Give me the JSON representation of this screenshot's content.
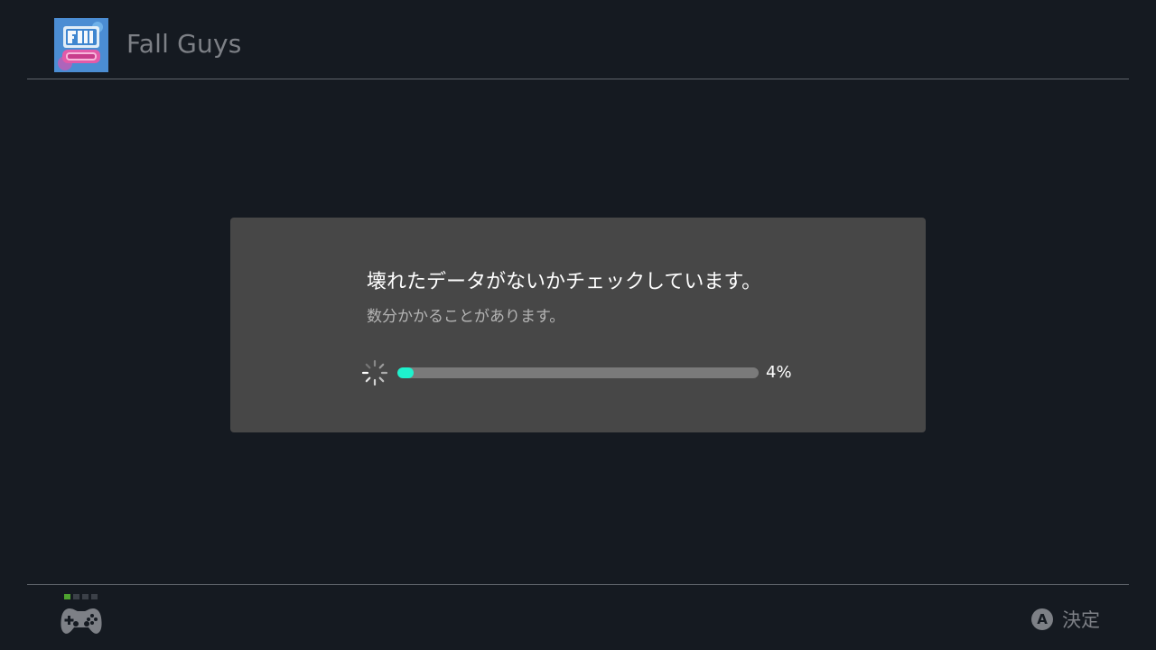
{
  "header": {
    "game_title": "Fall Guys",
    "game_icon": "fall-guys-game-icon"
  },
  "dialog": {
    "message": "壊れたデータがないかチェックしています。",
    "submessage": "数分かかることがあります。",
    "progress_percent": 4,
    "progress_label": "4%",
    "spinner_icon": "loading-spinner-icon"
  },
  "footer": {
    "players": {
      "total": 4,
      "active_index": 0,
      "icon": "controller-icon"
    },
    "confirm": {
      "button_glyph": "A",
      "label": "決定"
    }
  },
  "colors": {
    "background": "#151a21",
    "dialog": "#474747",
    "progress_fill": "#1ef2cd",
    "progress_track": "#7a7a7a",
    "player_active": "#4ea32f",
    "muted_text": "#7d8086"
  }
}
